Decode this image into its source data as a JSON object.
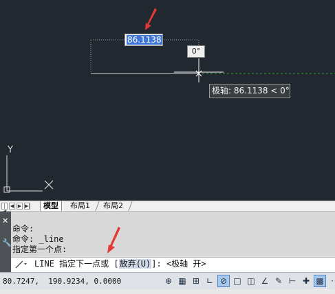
{
  "canvas": {
    "dim_value": "86.1138",
    "angle_label": "0°",
    "polar_tooltip": "极轴: 86.1138 < 0°",
    "ucs_y": "Y",
    "ucs_x": "X"
  },
  "tabs": {
    "nav": [
      "|◀",
      "◀",
      "▶",
      "▶|"
    ],
    "model": "模型",
    "layout1": "布局1",
    "layout2": "布局2"
  },
  "command": {
    "history": [
      "命令:",
      "命令: _line",
      "指定第一个点:"
    ],
    "prompt_prefix": "LINE 指定下一点或 [",
    "option": "放弃(U)",
    "prompt_suffix": "]:  <极轴 开>"
  },
  "status": {
    "coords": "80.7247,  190.9234, 0.0000",
    "buttons": [
      "model-space-icon",
      "grid-icon",
      "snap-icon",
      "ortho-icon",
      "polar-icon",
      "osnap-icon",
      "object-track-icon",
      "ucs-icon",
      "dynamic-input-icon",
      "lineweight-icon",
      "transparency-icon",
      "selection-cycling-icon",
      "annotation-icon"
    ]
  },
  "colors": {
    "canvas_bg": "#212830",
    "highlight": "#3f78d6",
    "tracking": "#2f9c3a"
  }
}
